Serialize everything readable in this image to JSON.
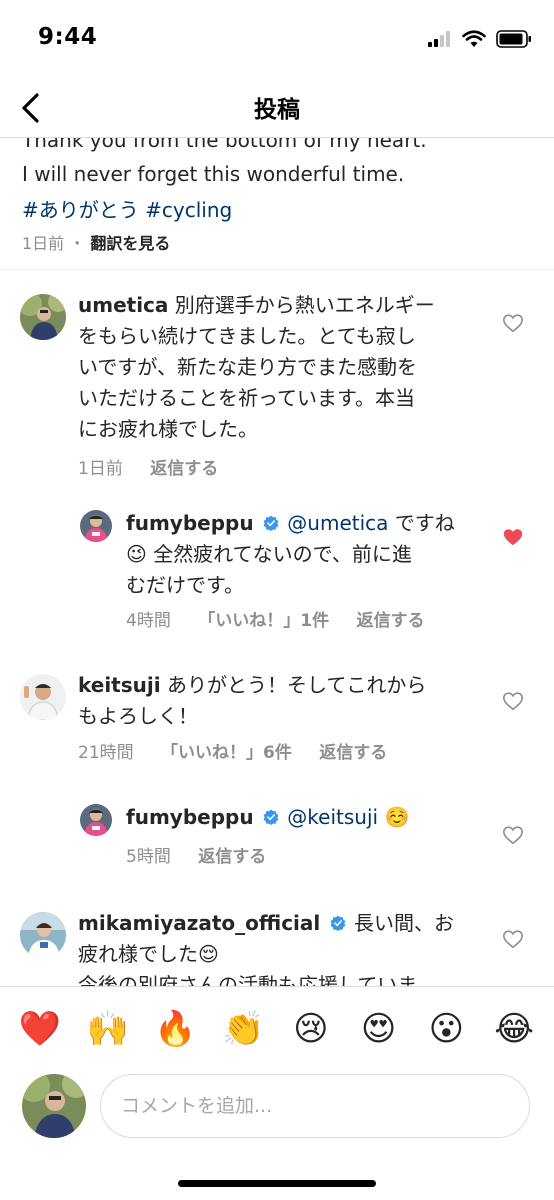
{
  "status_bar": {
    "time": "9:44"
  },
  "nav": {
    "title": "投稿"
  },
  "caption": {
    "line1": "Thank you from the bottom of my heart.",
    "line2": "I will never forget this wonderful time.",
    "hashtags": "#ありがとう #cycling",
    "time_ago": "1日前",
    "separator": "・",
    "translate_label": "翻訳を見る"
  },
  "comments": [
    {
      "username": "umetica",
      "text_lines": [
        "別府選手から熱いエネルギー",
        "をもらい続けてきました。とても寂し",
        "いですが、新たな走り方でまた感動を",
        "いただけることを祈っています。本当",
        "にお疲れ様でした。"
      ],
      "time": "1日前",
      "reply_label": "返信する",
      "liked": false
    },
    {
      "username": "fumybeppu",
      "verified": true,
      "mention": "@umetica",
      "text_first": "ですね",
      "emoji": "😉",
      "text_lines": [
        "全然疲れてないので、前に進",
        "むだけです。"
      ],
      "time": "4時間",
      "likes": "「いいね！」1件",
      "reply_label": "返信する",
      "liked": true
    },
    {
      "username": "keitsuji",
      "text_lines": [
        "ありがとう！そしてこれから",
        "もよろしく！"
      ],
      "time": "21時間",
      "likes": "「いいね！」6件",
      "reply_label": "返信する",
      "liked": false
    },
    {
      "username": "fumybeppu",
      "verified": true,
      "mention": "@keitsuji",
      "emoji": "☺️",
      "time": "5時間",
      "reply_label": "返信する",
      "liked": false
    },
    {
      "username": "mikamiyazato_official",
      "verified": true,
      "text_lines": [
        "長い間、お",
        "疲れ様でした",
        "今後の別府さんの活動も応援していま"
      ],
      "emoji": "😌",
      "liked": false
    }
  ],
  "emoji_bar": [
    "❤️",
    "🙌",
    "🔥",
    "👏",
    "😢",
    "😍",
    "😮",
    "😂"
  ],
  "composer": {
    "placeholder": "コメントを追加..."
  },
  "colors": {
    "link": "#00376b",
    "meta": "#8e8e8e",
    "heart_active": "#ed4956",
    "verified": "#3897f0"
  }
}
